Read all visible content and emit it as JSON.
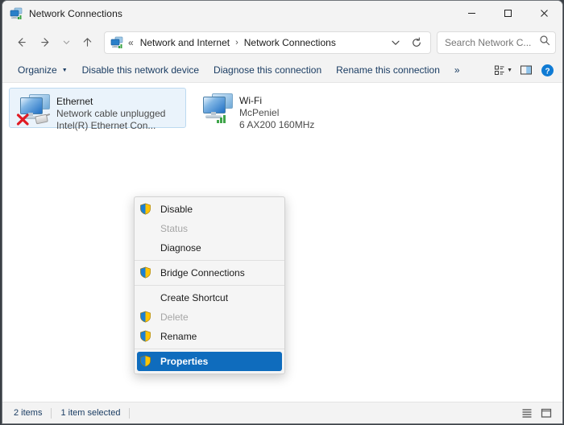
{
  "window": {
    "title": "Network Connections",
    "app_icon": "network-connections-icon",
    "controls": {
      "minimize": "minimize-icon",
      "maximize": "maximize-icon",
      "close": "close-icon"
    }
  },
  "nav": {
    "back": "back-arrow-icon",
    "forward": "forward-arrow-icon",
    "recent": "chevron-down-icon",
    "up": "up-arrow-icon"
  },
  "address": {
    "icon": "network-icon",
    "overflow": "«",
    "crumbs": [
      "Network and Internet",
      "Network Connections"
    ],
    "separator": "›",
    "dropdown": "chevron-down-icon",
    "refresh": "refresh-icon"
  },
  "search": {
    "placeholder": "Search Network C...",
    "icon": "search-icon"
  },
  "toolbar": {
    "organize": "Organize",
    "disable_device": "Disable this network device",
    "diagnose_connection": "Diagnose this connection",
    "rename_connection": "Rename this connection",
    "overflow": "»",
    "view_icon": "view-layout-icon",
    "view_chevron": "chevron-down-icon",
    "pane_icon": "preview-pane-icon",
    "help_icon": "help-icon"
  },
  "connections": [
    {
      "name": "Ethernet",
      "status": "Network cable unplugged",
      "device": "Intel(R) Ethernet Con...",
      "selected": true,
      "icon": "network-adapter-disconnected-icon"
    },
    {
      "name": "Wi-Fi",
      "status": "McPeniel",
      "device": "6 AX200 160MHz",
      "selected": false,
      "icon": "network-adapter-wireless-icon"
    }
  ],
  "context_menu": {
    "items": [
      {
        "label": "Disable",
        "shield": true,
        "disabled": false,
        "highlight": false,
        "sep_before": false
      },
      {
        "label": "Status",
        "shield": false,
        "disabled": true,
        "highlight": false,
        "sep_before": false
      },
      {
        "label": "Diagnose",
        "shield": false,
        "disabled": false,
        "highlight": false,
        "sep_before": false
      },
      {
        "label": "Bridge Connections",
        "shield": true,
        "disabled": false,
        "highlight": false,
        "sep_before": true
      },
      {
        "label": "Create Shortcut",
        "shield": false,
        "disabled": false,
        "highlight": false,
        "sep_before": true
      },
      {
        "label": "Delete",
        "shield": true,
        "disabled": true,
        "highlight": false,
        "sep_before": false
      },
      {
        "label": "Rename",
        "shield": true,
        "disabled": false,
        "highlight": false,
        "sep_before": false
      },
      {
        "label": "Properties",
        "shield": true,
        "disabled": false,
        "highlight": true,
        "sep_before": true
      }
    ]
  },
  "status_bar": {
    "item_count": "2 items",
    "selection": "1 item selected",
    "details_view_icon": "details-view-icon",
    "large_icons_view_icon": "large-icons-view-icon"
  },
  "colors": {
    "accent": "#0f6cbd",
    "link": "#1b3d63",
    "chrome": "#f3f3f3",
    "selection": "#eaf3fb",
    "error": "#e01b24",
    "signal": "#3fa54a"
  }
}
